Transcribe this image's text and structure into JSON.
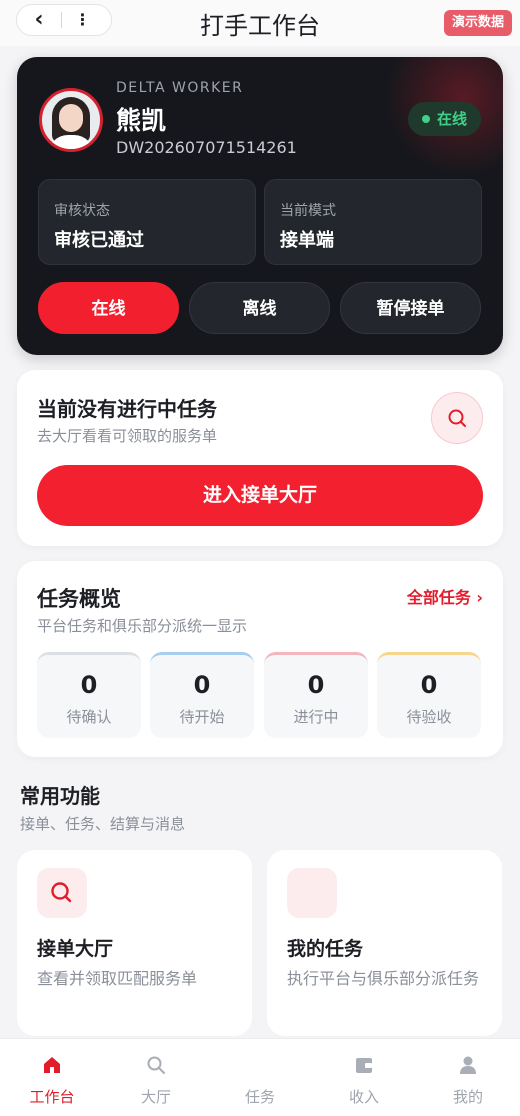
{
  "header": {
    "back_icon": "back-chevron-icon",
    "more_icon": "more-vertical-icon",
    "title": "打手工作台",
    "demo_badge": "演示数据"
  },
  "worker": {
    "brand": "DELTA WORKER",
    "name": "熊凯",
    "id": "DW202607071514261",
    "status": "在线",
    "status_color": "#42d088",
    "review": {
      "label": "审核状态",
      "value": "审核已通过"
    },
    "mode": {
      "label": "当前模式",
      "value": "接单端"
    },
    "mode_buttons": [
      "在线",
      "离线",
      "暂停接单"
    ],
    "active_mode": "在线",
    "accent": "#f2202f"
  },
  "current_task": {
    "title": "当前没有进行中任务",
    "subtitle": "去大厅看看可领取的服务单",
    "search_icon": "search-icon",
    "cta": "进入接单大厅"
  },
  "overview": {
    "title": "任务概览",
    "subtitle": "平台任务和俱乐部分派统一显示",
    "all_link": "全部任务 ›",
    "stats": [
      {
        "value": "0",
        "label": "待确认"
      },
      {
        "value": "0",
        "label": "待开始"
      },
      {
        "value": "0",
        "label": "进行中"
      },
      {
        "value": "0",
        "label": "待验收"
      }
    ]
  },
  "functions": {
    "title": "常用功能",
    "subtitle": "接单、任务、结算与消息",
    "items": [
      {
        "title": "接单大厅",
        "desc": "查看并领取匹配服务单",
        "icon": "search-icon"
      },
      {
        "title": "我的任务",
        "desc": "执行平台与俱乐部分派任务",
        "icon": "task-icon"
      }
    ]
  },
  "tabbar": {
    "items": [
      {
        "label": "工作台",
        "icon": "home-icon",
        "active": true
      },
      {
        "label": "大厅",
        "icon": "search-icon",
        "active": false
      },
      {
        "label": "任务",
        "icon": "task-icon",
        "active": false
      },
      {
        "label": "收入",
        "icon": "wallet-icon",
        "active": false
      },
      {
        "label": "我的",
        "icon": "user-icon",
        "active": false
      }
    ]
  }
}
